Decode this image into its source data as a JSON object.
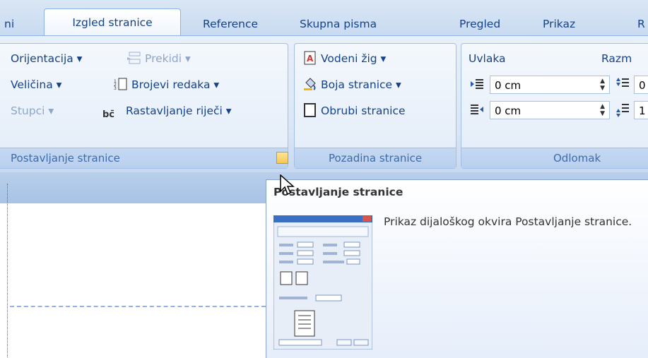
{
  "tabs": [
    {
      "label": "ni",
      "active": false
    },
    {
      "label": "Izgled stranice",
      "active": true
    },
    {
      "label": "Reference",
      "active": false
    },
    {
      "label": "Skupna pisma",
      "active": false
    },
    {
      "label": "Pregled",
      "active": false
    },
    {
      "label": "Prikaz",
      "active": false
    },
    {
      "label": "R",
      "active": false
    }
  ],
  "groups": {
    "page_setup": {
      "title": "Postavljanje stranice",
      "orientation": "Orijentacija ▾",
      "breaks": "Prekidi ▾",
      "size": "Veličina ▾",
      "line_numbers": "Brojevi redaka ▾",
      "columns": "Stupci ▾",
      "hyphenation": "Rastavljanje riječi ▾"
    },
    "background": {
      "title": "Pozadina stranice",
      "watermark": "Vodeni žig ▾",
      "page_color": "Boja stranice ▾",
      "page_borders": "Obrubi stranice"
    },
    "paragraph": {
      "title": "Odlomak",
      "indent_label": "Uvlaka",
      "indent_left": "0 cm",
      "indent_right": "0 cm",
      "spacing_label": "Razm",
      "spacing_before": "0",
      "spacing_after": "1"
    }
  },
  "tooltip": {
    "title": "Postavljanje stranice",
    "body": "Prikaz dijaloškog okvira Postavljanje stranice."
  },
  "colors": {
    "accent": "#15428b",
    "ribbon": "#dae6f6"
  }
}
